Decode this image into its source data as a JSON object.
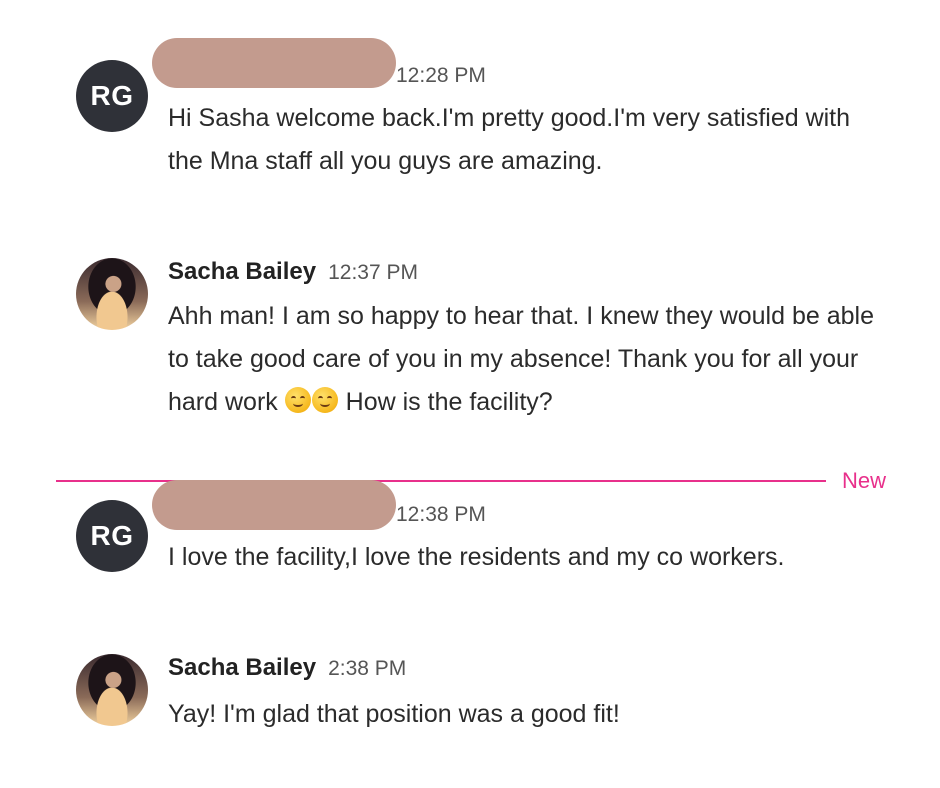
{
  "messages": [
    {
      "avatar_initials": "RG",
      "sender": "",
      "time": "12:28 PM",
      "text": "Hi Sasha welcome back.I'm pretty good.I'm very satisfied with the Mna staff all you guys are amazing."
    },
    {
      "avatar_initials": "",
      "sender": "Sacha Bailey",
      "time": "12:37 PM",
      "text_before_emoji": "Ahh man! I am so happy to hear that. I knew they would be able to take good care of you in my absence! Thank you for all your hard work ",
      "emoji": [
        "smiling-face-icon",
        "smiling-face-icon"
      ],
      "text_after_emoji": " How is the facility?"
    },
    {
      "avatar_initials": "RG",
      "sender": "",
      "time": "12:38 PM",
      "text": "I love the facility,I love the residents and my co workers."
    },
    {
      "avatar_initials": "",
      "sender": "Sacha Bailey",
      "time": "2:38 PM",
      "text": "Yay! I'm glad that position was a good fit!"
    }
  ],
  "divider": {
    "label": "New",
    "color": "#e8308b"
  },
  "colors": {
    "rg_avatar_bg": "#2f3138",
    "redaction": "#c39b8e"
  }
}
